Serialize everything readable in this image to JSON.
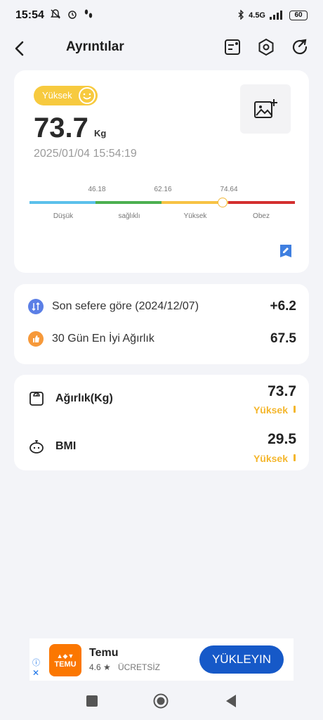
{
  "status_bar": {
    "time": "15:54",
    "network": "4.5G",
    "battery": "60"
  },
  "header": {
    "title": "Ayrıntılar"
  },
  "summary": {
    "level_label": "Yüksek",
    "weight": "73.7",
    "unit": "Kg",
    "timestamp": "2025/01/04 15:54:19",
    "thresholds": [
      "46.18",
      "62.16",
      "74.64"
    ],
    "ranges": [
      "Düşük",
      "sağlıklı",
      "Yüksek",
      "Obez"
    ],
    "colors": [
      "#5bc0eb",
      "#4caf50",
      "#f7c244",
      "#d32f2f"
    ]
  },
  "comparison": {
    "items": [
      {
        "label": "Son sefere göre (2024/12/07)",
        "value": "+6.2",
        "icon": "compare-icon"
      },
      {
        "label": "30 Gün En İyi Ağırlık",
        "value": "67.5",
        "icon": "thumb-up-icon"
      }
    ]
  },
  "metrics": [
    {
      "name": "Ağırlık(Kg)",
      "value": "73.7",
      "status": "Yüksek",
      "icon": "scale-icon"
    },
    {
      "name": "BMI",
      "value": "29.5",
      "status": "Yüksek",
      "icon": "bmi-icon"
    }
  ],
  "ad": {
    "app_name": "Temu",
    "rating": "4.6 ★",
    "price": "ÜCRETSİZ",
    "cta": "YÜKLEYIN",
    "logo_text": "TEMU"
  }
}
